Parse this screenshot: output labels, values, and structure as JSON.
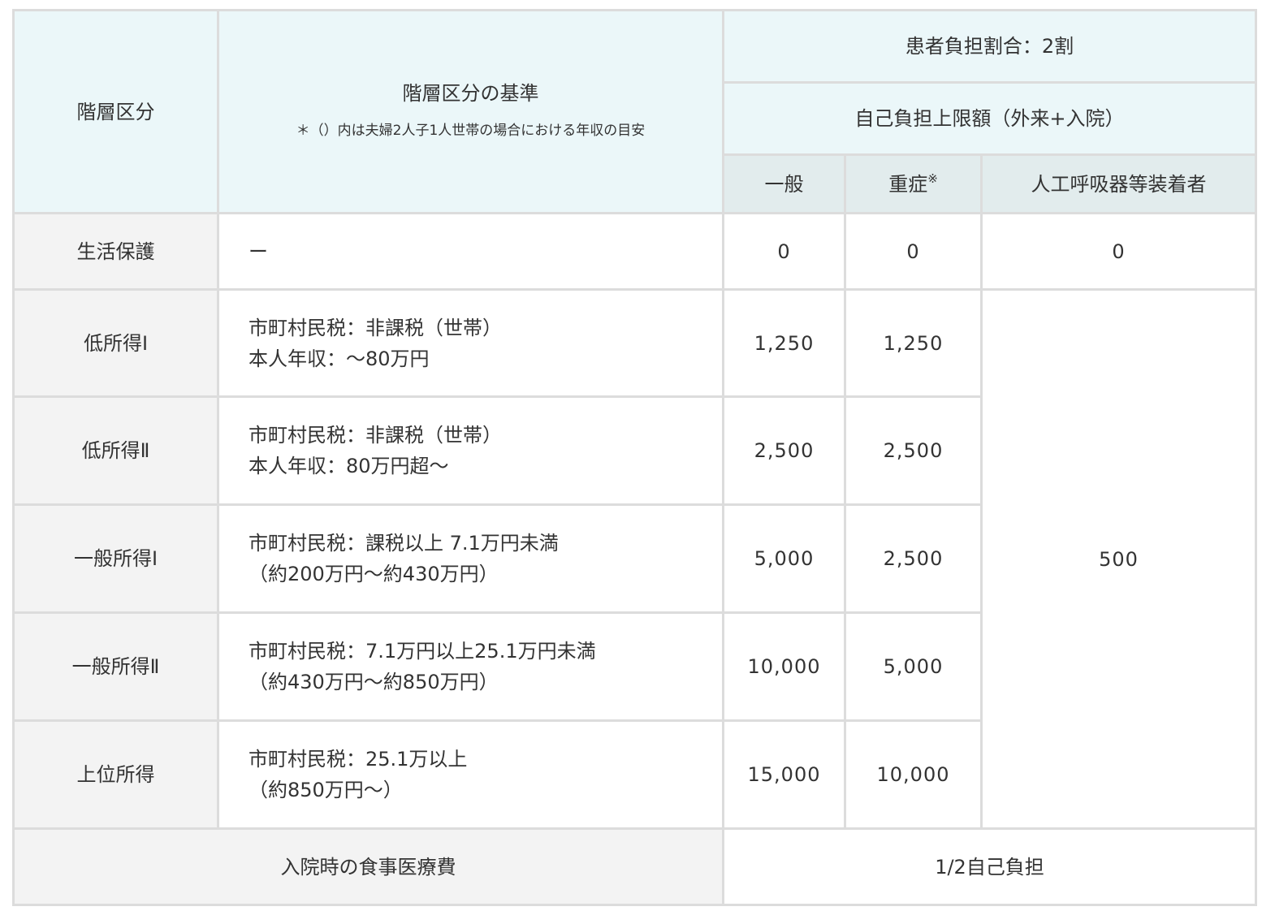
{
  "header": {
    "tier": "階層区分",
    "criteria_title": "階層区分の基準",
    "criteria_note": "＊（）内は夫婦2人子1人世帯の場合における年収の目安",
    "burden_ratio": "患者負担割合：2割",
    "limit_title": "自己負担上限額（外来+入院）",
    "col_general": "一般",
    "col_severe": "重症",
    "col_severe_mark": "※",
    "col_ventilator": "人工呼吸器等装着者"
  },
  "rows": [
    {
      "tier": "生活保護",
      "line1": "ー",
      "line2": "",
      "general": "0",
      "severe": "0",
      "ventilator": "0"
    },
    {
      "tier": "低所得Ⅰ",
      "line1": "市町村民税：非課税（世帯）",
      "line2": "本人年収：〜80万円",
      "general": "1,250",
      "severe": "1,250"
    },
    {
      "tier": "低所得Ⅱ",
      "line1": "市町村民税：非課税（世帯）",
      "line2": "本人年収：80万円超〜",
      "general": "2,500",
      "severe": "2,500"
    },
    {
      "tier": "一般所得Ⅰ",
      "line1": "市町村民税：課税以上 7.1万円未満",
      "line2": "（約200万円〜約430万円）",
      "general": "5,000",
      "severe": "2,500"
    },
    {
      "tier": "一般所得Ⅱ",
      "line1": "市町村民税：7.1万円以上25.1万円未満",
      "line2": "（約430万円〜約850万円）",
      "general": "10,000",
      "severe": "5,000"
    },
    {
      "tier": "上位所得",
      "line1": "市町村民税：25.1万以上",
      "line2": "（約850万円〜）",
      "general": "15,000",
      "severe": "10,000"
    }
  ],
  "ventilator_shared": "500",
  "footer": {
    "label": "入院時の食事医療費",
    "value": "1/2自己負担"
  }
}
